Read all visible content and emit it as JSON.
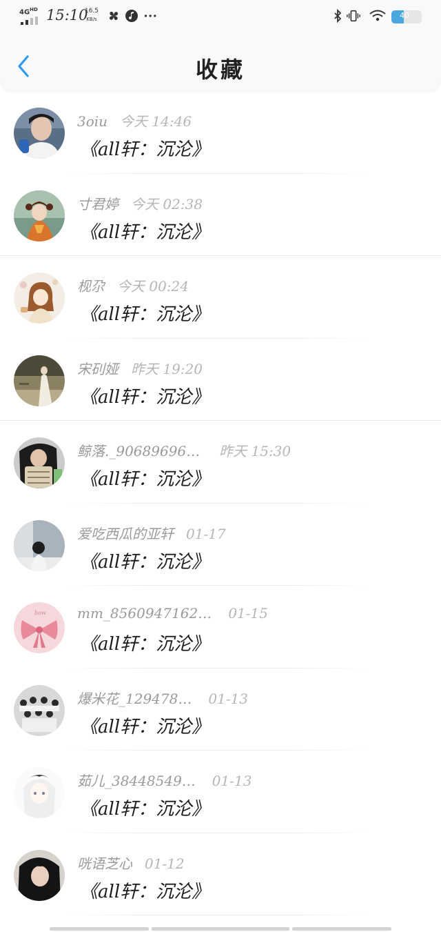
{
  "status_bar": {
    "network": "4G",
    "network_suffix": "HD",
    "time": "15:10",
    "speed_value": "16.5",
    "speed_unit": "KB/s",
    "battery": "40",
    "icons": [
      "pinwheel-icon",
      "music-icon",
      "more-dots-icon",
      "bluetooth-icon",
      "vibrate-icon",
      "wifi-icon",
      "battery-icon"
    ]
  },
  "nav": {
    "back_icon": "chevron-left-icon",
    "title": "收藏"
  },
  "colors": {
    "accent": "#2a9bf0",
    "meta_text": "#9a9a9a",
    "battery_fill": "#4aa8e0"
  },
  "items": [
    {
      "user": "3oiu",
      "time": "今天 14:46",
      "content": "《all轩：沉沦》"
    },
    {
      "user": "寸君婷",
      "time": "今天 02:38",
      "content": "《all轩：沉沦》"
    },
    {
      "user": "枧尕",
      "time": "今天 00:24",
      "content": "《all轩：沉沦》"
    },
    {
      "user": "宋矵娅",
      "time": "昨天 19:20",
      "content": "《all轩：沉沦》"
    },
    {
      "user": "鲸落._90689696…",
      "time": "昨天 15:30",
      "content": "《all轩：沉沦》"
    },
    {
      "user": "爱吃西瓜的亚轩",
      "time": "01-17",
      "content": "《all轩：沉沦》"
    },
    {
      "user": "mm_8560947162…",
      "time": "01-15",
      "content": "《all轩：沉沦》"
    },
    {
      "user": "爆米花_129478…",
      "time": "01-13",
      "content": "《all轩：沉沦》"
    },
    {
      "user": "茹儿_38448549…",
      "time": "01-13",
      "content": "《all轩：沉沦》"
    },
    {
      "user": "咣语芝心",
      "time": "01-12",
      "content": "《all轩：沉沦》"
    }
  ]
}
